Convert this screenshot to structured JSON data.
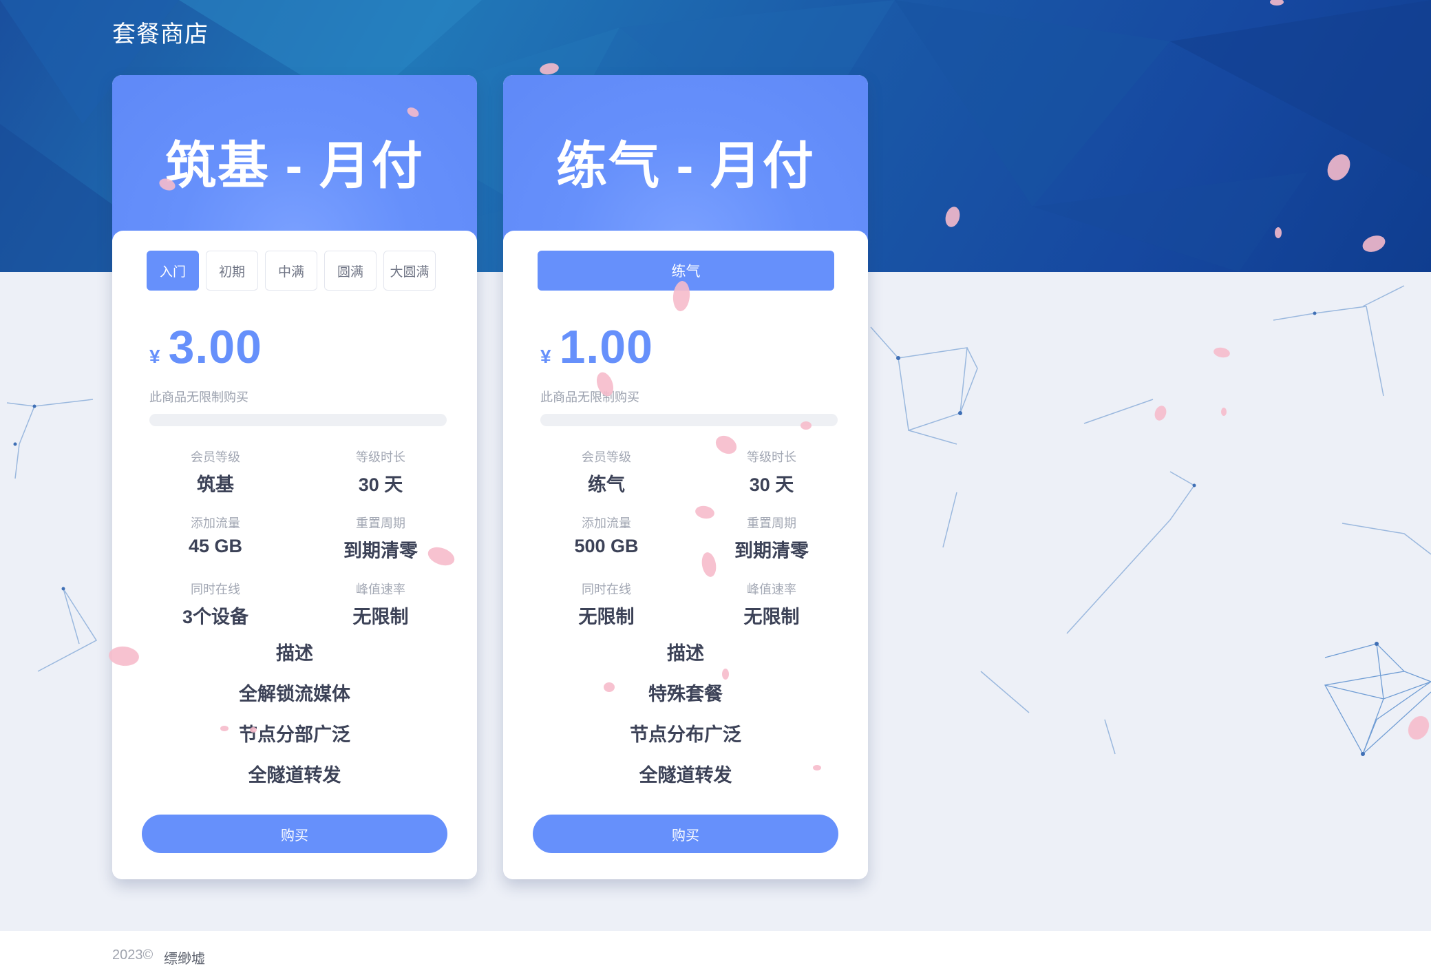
{
  "header": {
    "title": "套餐商店"
  },
  "plans": [
    {
      "title": "筑基 - 月付",
      "tabs": [
        "入门",
        "初期",
        "中满",
        "圆满",
        "大圆满"
      ],
      "active_tab": "入门",
      "currency": "¥",
      "price": "3.00",
      "limit_note": "此商品无限制购买",
      "stats": [
        {
          "label": "会员等级",
          "value": "筑基"
        },
        {
          "label": "等级时长",
          "value": "30 天"
        },
        {
          "label": "添加流量",
          "value": "45 GB"
        },
        {
          "label": "重置周期",
          "value": "到期清零"
        },
        {
          "label": "同时在线",
          "value": "3个设备"
        },
        {
          "label": "峰值速率",
          "value": "无限制"
        }
      ],
      "description": [
        "描述",
        "全解锁流媒体",
        "节点分部广泛",
        "全隧道转发"
      ],
      "buy_label": "购买"
    },
    {
      "title": "练气 - 月付",
      "tabs": [
        "练气"
      ],
      "active_tab": "练气",
      "currency": "¥",
      "price": "1.00",
      "limit_note": "此商品无限制购买",
      "stats": [
        {
          "label": "会员等级",
          "value": "练气"
        },
        {
          "label": "等级时长",
          "value": "30 天"
        },
        {
          "label": "添加流量",
          "value": "500 GB"
        },
        {
          "label": "重置周期",
          "value": "到期清零"
        },
        {
          "label": "同时在线",
          "value": "无限制"
        },
        {
          "label": "峰值速率",
          "value": "无限制"
        }
      ],
      "description": [
        "描述",
        "特殊套餐",
        "节点分布广泛",
        "全隧道转发"
      ],
      "buy_label": "购买"
    }
  ],
  "footer": {
    "copyright": "2023©",
    "brand": "缥缈墟"
  },
  "colors": {
    "accent": "#6690fb",
    "hero": "#1a5aa8",
    "page_bg": "#edf0f7"
  }
}
